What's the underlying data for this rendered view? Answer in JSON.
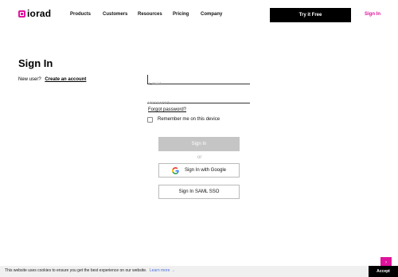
{
  "brand": {
    "name": "iorad",
    "accent": "#e0139c"
  },
  "nav": {
    "items": [
      "Products",
      "Customers",
      "Resources",
      "Pricing",
      "Company"
    ],
    "cta": "Try it Free",
    "signin": "Sign In"
  },
  "page": {
    "title": "Sign In",
    "new_user_label": "New user?",
    "create_account": "Create an account"
  },
  "form": {
    "email_placeholder": "Email",
    "password_placeholder": "Password",
    "forgot": "Forgot password?",
    "remember": "Remember me on this device",
    "remember_checked": false,
    "submit": "Sign In",
    "or": "or",
    "google": "Sign In with Google",
    "saml": "Sign In SAML SSO"
  },
  "cookie": {
    "text": "This website uses cookies to ensure you get the best experience on our website.",
    "learn_more": "Learn more →",
    "accept": "Accept"
  },
  "scroll_top_icon": "chevron-up-icon"
}
